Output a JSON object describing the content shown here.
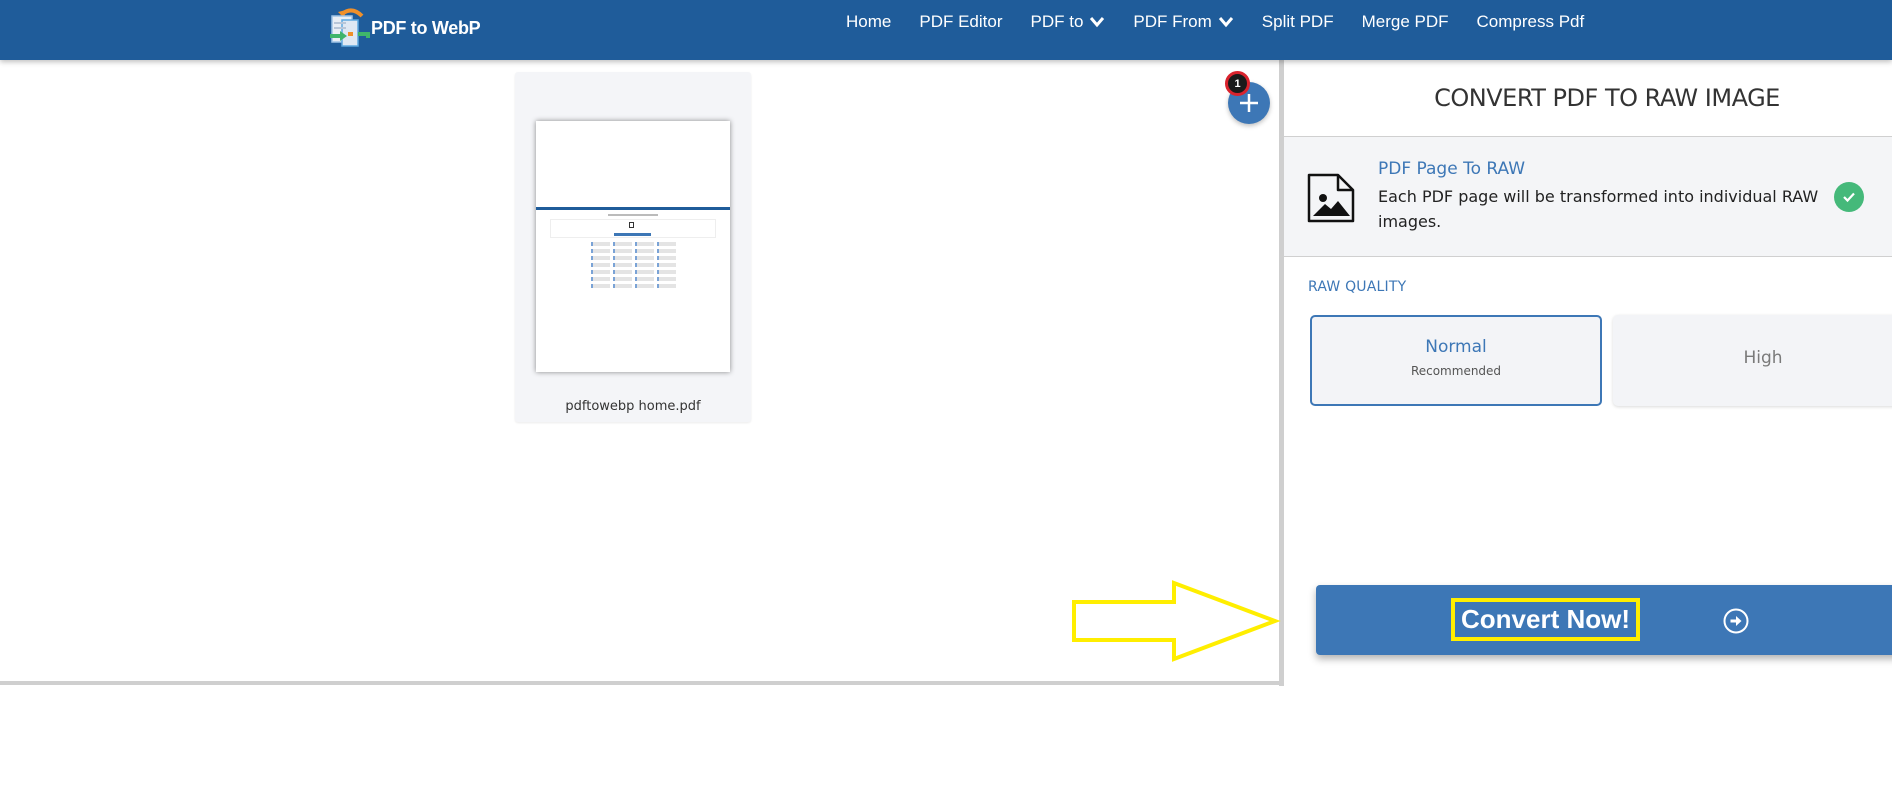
{
  "header": {
    "brand": "PDF to WebP",
    "nav": [
      {
        "label": "Home",
        "dropdown": false
      },
      {
        "label": "PDF Editor",
        "dropdown": false
      },
      {
        "label": "PDF to",
        "dropdown": true
      },
      {
        "label": "PDF From",
        "dropdown": true
      },
      {
        "label": "Split PDF",
        "dropdown": false
      },
      {
        "label": "Merge PDF",
        "dropdown": false
      },
      {
        "label": "Compress Pdf",
        "dropdown": false
      }
    ]
  },
  "workspace": {
    "files": [
      {
        "name": "pdftowebp home.pdf"
      }
    ],
    "file_count_badge": "1",
    "add_icon": "plus-icon"
  },
  "panel": {
    "title": "CONVERT PDF TO RAW IMAGE",
    "option": {
      "title": "PDF Page To RAW",
      "description": "Each PDF page will be transformed into individual RAW images.",
      "icon": "image-file-icon",
      "selected": true
    },
    "quality": {
      "label": "RAW QUALITY",
      "options": [
        {
          "name": "Normal",
          "sub": "Recommended",
          "selected": true
        },
        {
          "name": "High",
          "sub": "",
          "selected": false
        }
      ]
    },
    "convert": {
      "label": "Convert Now!",
      "icon": "arrow-circle-right-icon"
    }
  },
  "colors": {
    "header_bg": "#1f5c9a",
    "accent": "#3d77b6",
    "success": "#45b97a",
    "annotation": "#ffee00",
    "badge_border": "#d9232d"
  }
}
